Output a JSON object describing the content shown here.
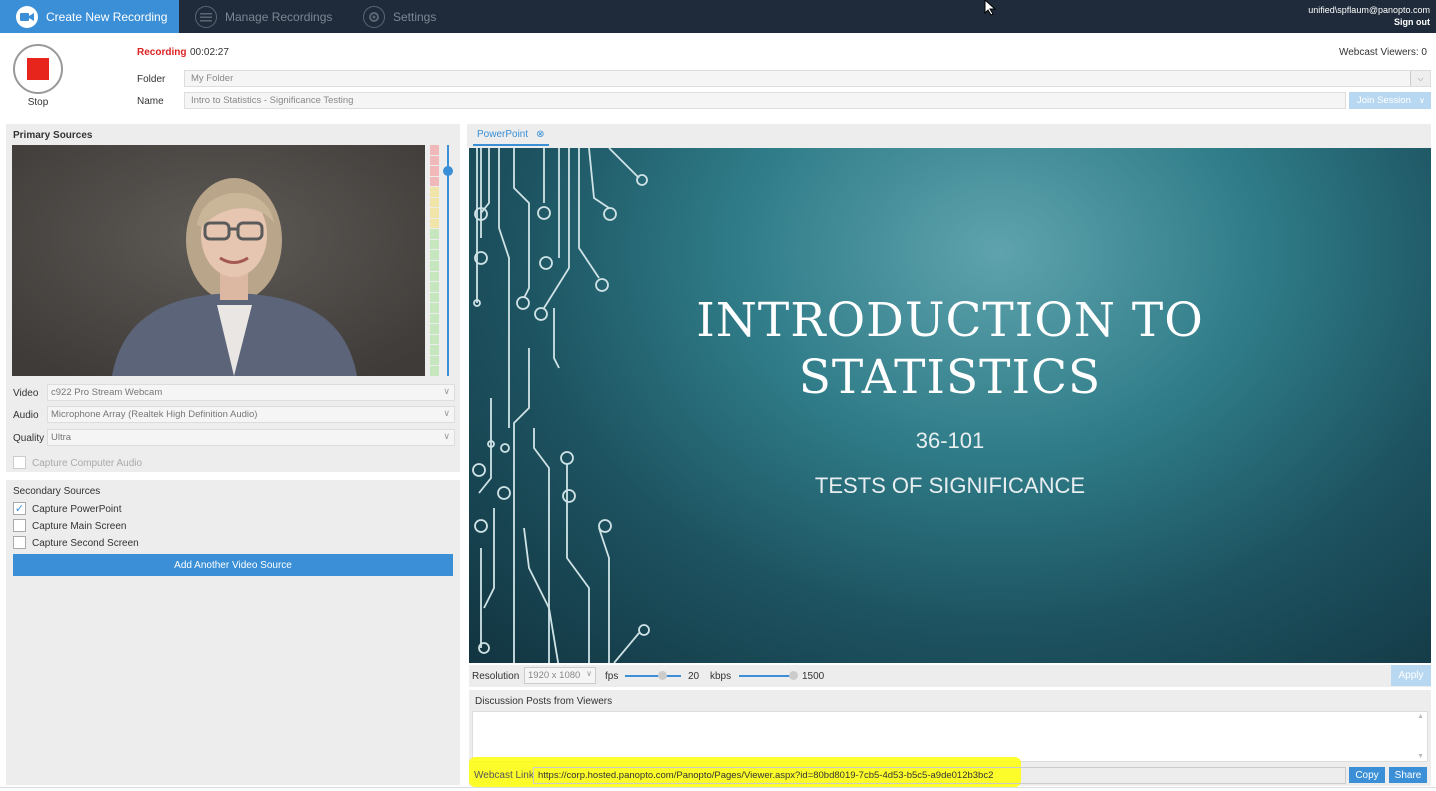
{
  "nav": {
    "tabs": [
      {
        "label": "Create New Recording",
        "icon": "video-camera-icon",
        "active": true
      },
      {
        "label": "Manage Recordings",
        "icon": "list-icon",
        "active": false
      },
      {
        "label": "Settings",
        "icon": "gear-icon",
        "active": false
      }
    ],
    "user": "unified\\spflaum@panopto.com",
    "sign_out": "Sign out"
  },
  "recording": {
    "stop_label": "Stop",
    "status": "Recording",
    "elapsed": "00:02:27",
    "webcast_viewers": "Webcast Viewers: 0",
    "folder_label": "Folder",
    "folder_value": "My Folder",
    "name_label": "Name",
    "name_value": "Intro to Statistics - Significance Testing",
    "join_session": "Join Session"
  },
  "primary_sources": {
    "title": "Primary Sources",
    "video_label": "Video",
    "video_value": "c922 Pro Stream Webcam",
    "audio_label": "Audio",
    "audio_value": "Microphone Array (Realtek High Definition Audio)",
    "quality_label": "Quality",
    "quality_value": "Ultra",
    "capture_audio": "Capture Computer Audio"
  },
  "secondary_sources": {
    "title": "Secondary Sources",
    "items": [
      {
        "label": "Capture PowerPoint",
        "checked": true
      },
      {
        "label": "Capture Main Screen",
        "checked": false
      },
      {
        "label": "Capture Second Screen",
        "checked": false
      }
    ],
    "add_button": "Add Another Video Source"
  },
  "powerpoint": {
    "tab_label": "PowerPoint",
    "slide": {
      "line1": "INTRODUCTION TO",
      "line2": "STATISTICS",
      "code": "36-101",
      "subtitle": "TESTS OF SIGNIFICANCE"
    },
    "resolution_label": "Resolution",
    "resolution_value": "1920 x 1080",
    "fps_label": "fps",
    "fps_value": "20",
    "kbps_label": "kbps",
    "kbps_value": "1500",
    "apply": "Apply"
  },
  "discussion": {
    "title": "Discussion Posts from Viewers",
    "webcast_link_label": "Webcast Link",
    "webcast_link": "https://corp.hosted.panopto.com/Panopto/Pages/Viewer.aspx?id=80bd8019-7cb5-4d53-b5c5-a9de012b3bc2",
    "copy": "Copy",
    "share": "Share"
  },
  "colors": {
    "accent": "#3a8fd6",
    "nav_bg": "#1f2b3a",
    "stop_red": "#e8251d",
    "highlight": "#ffff00"
  }
}
